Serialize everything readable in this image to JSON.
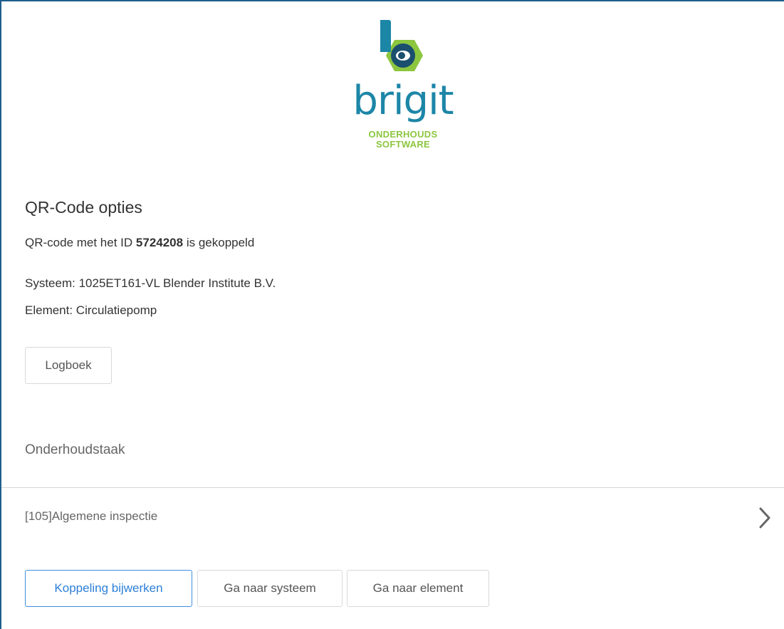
{
  "logo": {
    "wordmark": "brigit",
    "subtitle_line1": "ONDERHOUDS",
    "subtitle_line2": "SOFTWARE",
    "colors": {
      "teal": "#1c86a7",
      "green": "#8cc63f",
      "dark": "#1b4f6e"
    }
  },
  "qr": {
    "title": "QR-Code opties",
    "id_prefix": "QR-code met het ID",
    "id_value": "5724208",
    "id_suffix": "is gekoppeld",
    "system_line": "Systeem: 1025ET161-VL Blender Institute B.V.",
    "element_line": "Element: Circulatiepomp",
    "logbook_button": "Logboek"
  },
  "maintenance": {
    "section_label": "Onderhoudstaak",
    "task_label": "[105]Algemene inspectie",
    "chevron_icon": "chevron-right-icon"
  },
  "actions": {
    "update_link": "Koppeling bijwerken",
    "go_to_system": "Ga naar systeem",
    "go_to_element": "Ga naar element"
  },
  "colors": {
    "accent": "#2d7fd9",
    "frame_border": "#1f5f8b"
  }
}
